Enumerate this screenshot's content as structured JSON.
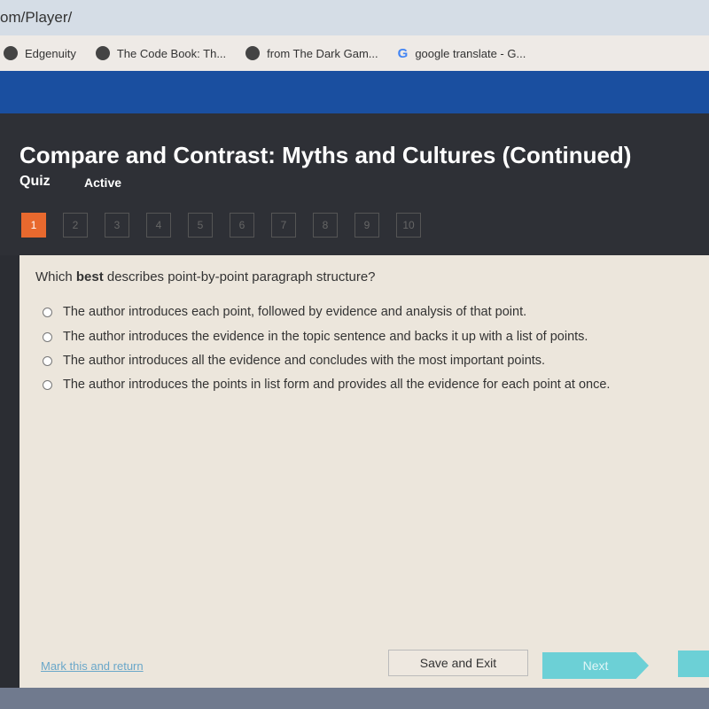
{
  "browser": {
    "url": "om/Player/",
    "bookmarks": [
      {
        "label": "Edgenuity",
        "icon": "globe-icon"
      },
      {
        "label": "The Code Book: Th...",
        "icon": "globe-icon"
      },
      {
        "label": "from The Dark Gam...",
        "icon": "globe-icon"
      },
      {
        "label": "google translate - G...",
        "icon": "google-icon"
      }
    ]
  },
  "header": {
    "title": "Compare and Contrast: Myths and Cultures (Continued)",
    "type": "Quiz",
    "status": "Active"
  },
  "questions": [
    "1",
    "2",
    "3",
    "4",
    "5",
    "6",
    "7",
    "8",
    "9",
    "10"
  ],
  "question": {
    "pre": "Which ",
    "bold": "best",
    "post": " describes point-by-point paragraph structure?",
    "options": [
      "The author introduces each point, followed by evidence and analysis of that point.",
      "The author introduces the evidence in the topic sentence and backs it up with a list of points.",
      "The author introduces all the evidence and concludes with the most important points.",
      "The author introduces the points in list form and provides all the evidence for each point at once."
    ]
  },
  "footer": {
    "mark": "Mark this and return",
    "save": "Save and Exit",
    "next": "Next"
  },
  "colors": {
    "accent": "#e8692e",
    "next": "#6cd0d6",
    "brand": "#1a4fa0"
  }
}
